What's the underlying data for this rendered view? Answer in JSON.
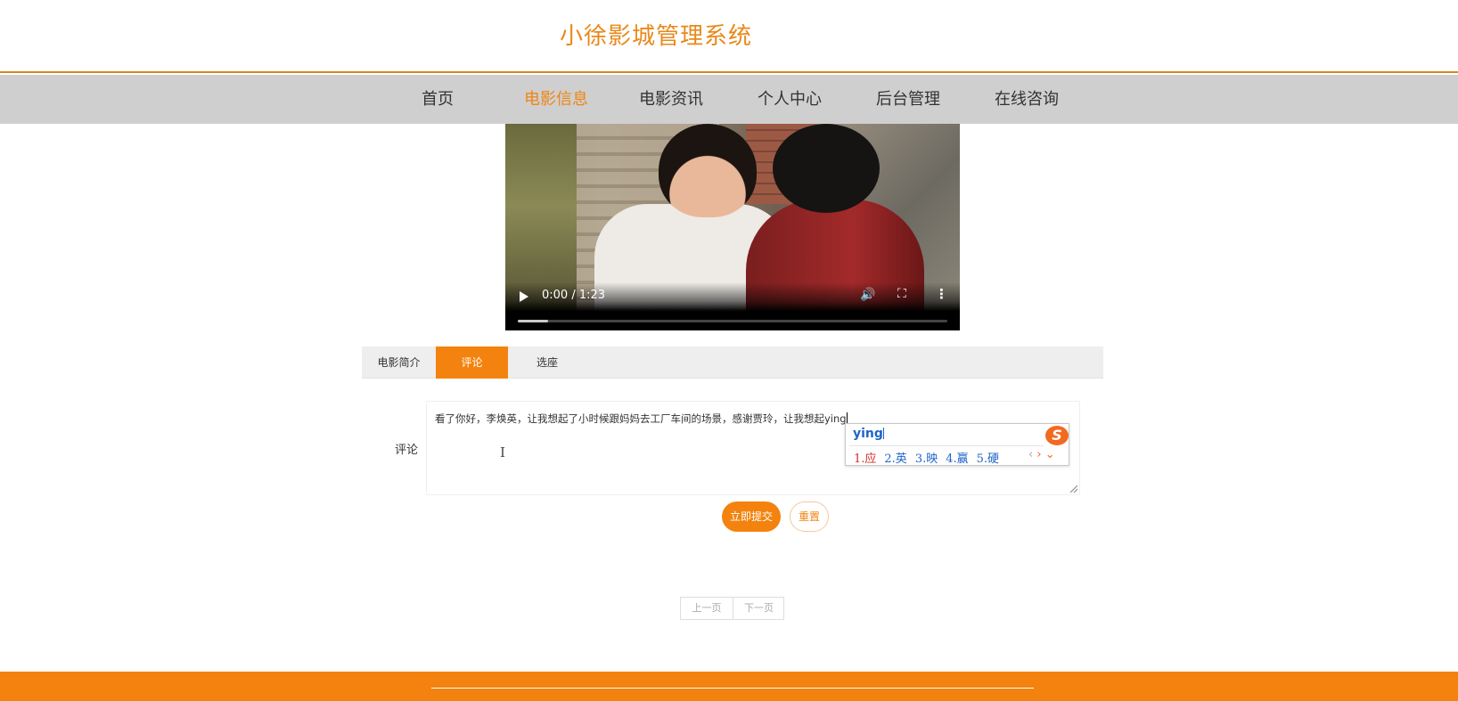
{
  "site": {
    "title": "小徐影城管理系统"
  },
  "nav": {
    "items": [
      {
        "label": "首页",
        "active": false
      },
      {
        "label": "电影信息",
        "active": true
      },
      {
        "label": "电影资讯",
        "active": false
      },
      {
        "label": "个人中心",
        "active": false
      },
      {
        "label": "后台管理",
        "active": false
      },
      {
        "label": "在线咨询",
        "active": false
      }
    ]
  },
  "video": {
    "time": "0:00 / 1:23",
    "progress": 0.07,
    "icons": {
      "play": "play-icon",
      "volume": "volume-icon",
      "fullscreen": "fullscreen-icon",
      "more": "more-vertical-icon"
    }
  },
  "tabs": [
    {
      "label": "电影简介",
      "active": false
    },
    {
      "label": "评论",
      "active": true
    },
    {
      "label": "选座",
      "active": false
    }
  ],
  "comment": {
    "label": "评论",
    "value": "看了你好，李焕英，让我想起了小时候跟妈妈去工厂车间的场景，感谢贾玲，让我想起ying"
  },
  "ime": {
    "input": "ying",
    "candidates": [
      "1.应",
      "2.英",
      "3.映",
      "4.赢",
      "5.硬"
    ],
    "logo": "S"
  },
  "buttons": {
    "submit": "立即提交",
    "reset": "重置"
  },
  "pager": {
    "prev": "上一页",
    "next": "下一页"
  },
  "colors": {
    "accent": "#f3830e",
    "title": "#e8891a",
    "nav_bg": "#cfcfcf"
  }
}
